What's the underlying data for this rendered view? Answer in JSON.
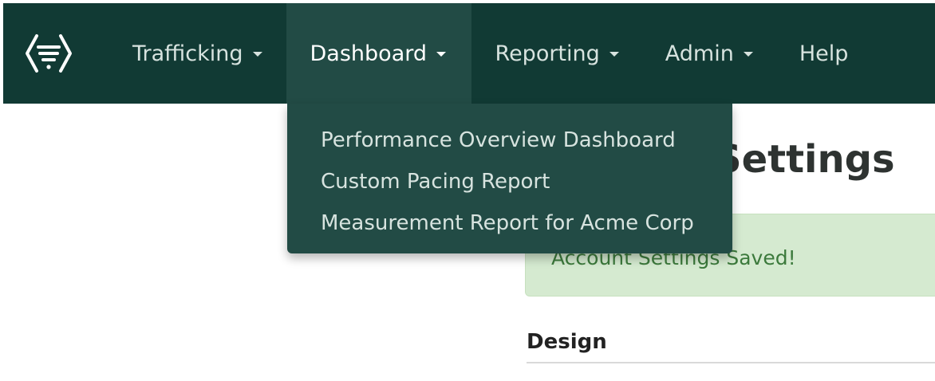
{
  "nav": {
    "logo_icon": "brand-logo-icon",
    "items": [
      {
        "label": "Trafficking",
        "has_menu": true
      },
      {
        "label": "Dashboard",
        "has_menu": true,
        "active": true
      },
      {
        "label": "Reporting",
        "has_menu": true
      },
      {
        "label": "Admin",
        "has_menu": true
      },
      {
        "label": "Help",
        "has_menu": false
      }
    ],
    "caret_icon": "caret-down-icon"
  },
  "dashboard_menu": {
    "items": [
      {
        "label": "Performance Overview Dashboard"
      },
      {
        "label": "Custom Pacing Report"
      },
      {
        "label": "Measurement Report for Acme Corp"
      }
    ]
  },
  "main": {
    "title": "Account Settings",
    "alert": "Account Settings Saved!",
    "section_heading": "Design"
  },
  "colors": {
    "navbar_bg": "#113a34",
    "active_bg": "#224b45",
    "alert_bg": "#d5ead0",
    "alert_text": "#3c7a3c"
  }
}
